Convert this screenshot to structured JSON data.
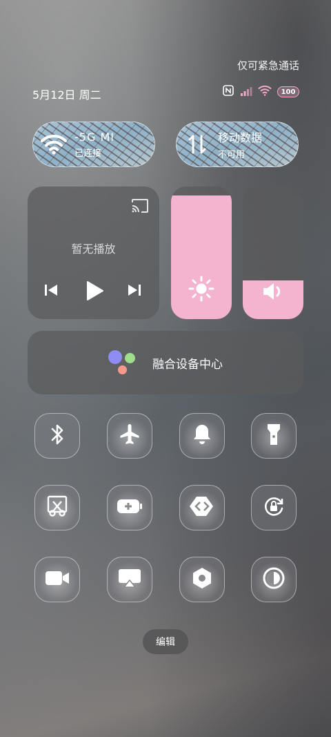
{
  "status_bar": {
    "emergency_text": "仅可紧急通话",
    "date_text": "5月12日 周二",
    "battery": "100"
  },
  "wifi_pill": {
    "line1": "-5G     MI",
    "line2": "已连接"
  },
  "mobile_pill": {
    "line1": "移动数据",
    "line2": "不可用"
  },
  "media": {
    "no_playback": "暂无播放"
  },
  "sliders": {
    "brightness_level": 0.93,
    "volume_level": 0.29
  },
  "fusion": {
    "label": "融合设备中心"
  },
  "toggles": [
    {
      "icon": "bluetooth-icon",
      "active": true
    },
    {
      "icon": "airplane-icon",
      "active": false
    },
    {
      "icon": "bell-icon",
      "active": false
    },
    {
      "icon": "flashlight-icon",
      "active": false
    },
    {
      "icon": "screenshot-icon",
      "active": false
    },
    {
      "icon": "battery-saver-icon",
      "active": false
    },
    {
      "icon": "link-icon",
      "active": false
    },
    {
      "icon": "rotation-lock-icon",
      "active": true
    },
    {
      "icon": "video-icon",
      "active": false
    },
    {
      "icon": "cast-screen-icon",
      "active": false
    },
    {
      "icon": "settings-icon",
      "active": false
    },
    {
      "icon": "dark-mode-icon",
      "active": false
    }
  ],
  "edit": {
    "label": "编辑"
  },
  "colors": {
    "accent": "#f4b3cf",
    "signal_pink": "#f6a9c7"
  }
}
